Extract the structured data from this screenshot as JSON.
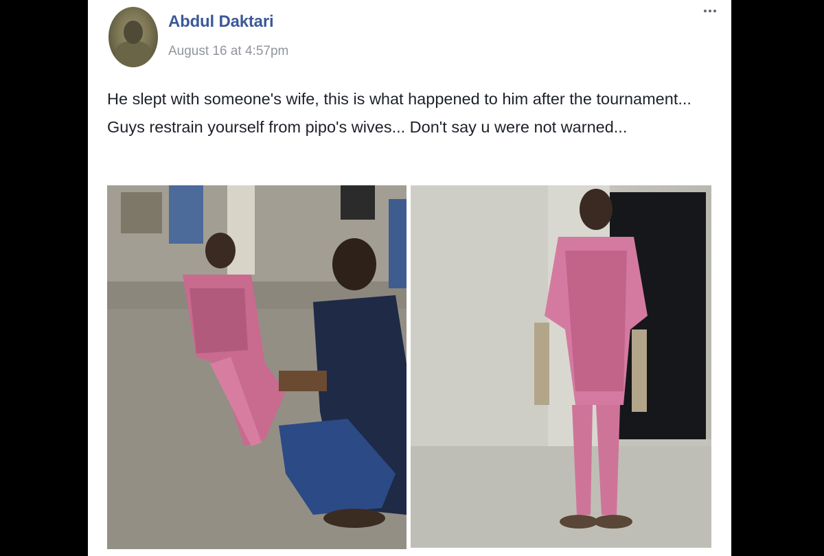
{
  "post": {
    "author": "Abdul Daktari",
    "timestamp": "August 16 at 4:57pm",
    "text": "He slept with someone's wife, this is what happened to him after the tournament... Guys restrain yourself from pipo's wives... Don't say u were not warned...",
    "more_icon": "more-options-icon"
  },
  "photos": [
    {
      "description": "photo-1"
    },
    {
      "description": "photo-2"
    }
  ]
}
